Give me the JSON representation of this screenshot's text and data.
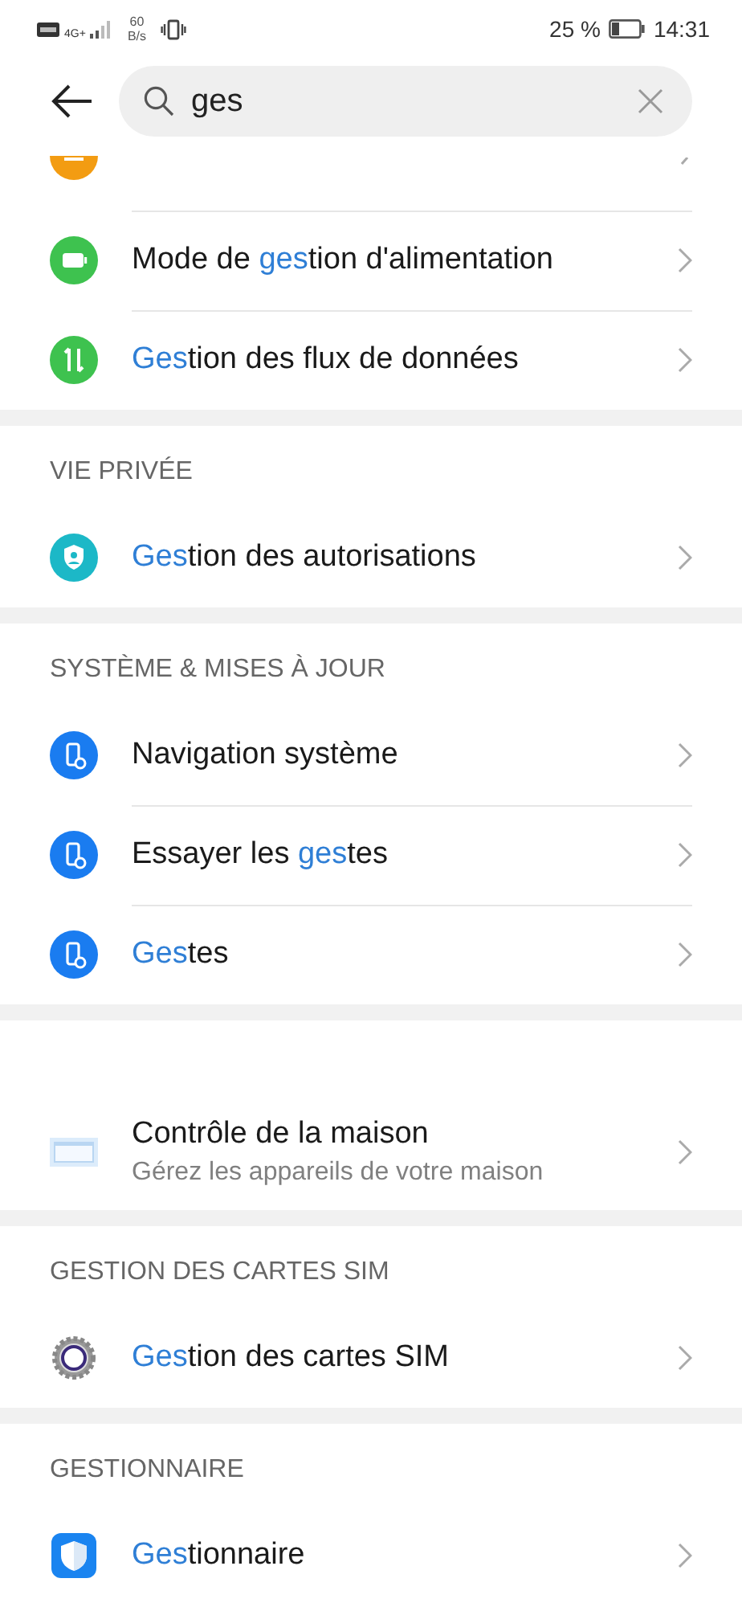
{
  "status_bar": {
    "network": "4G+",
    "speed_value": "60",
    "speed_unit": "B/s",
    "battery_percent": "25 %",
    "time": "14:31"
  },
  "search": {
    "value": "ges"
  },
  "sections": [
    {
      "items": [
        {
          "kind": "partial"
        },
        {
          "title": [
            {
              "text": "Mode de ",
              "highlighted": false
            },
            {
              "text": "ges",
              "highlighted": true
            },
            {
              "text": "tion d'alimentation",
              "highlighted": false
            }
          ]
        },
        {
          "title": [
            {
              "text": "Ges",
              "highlighted": true
            },
            {
              "text": "tion des flux de données",
              "highlighted": false
            }
          ]
        }
      ]
    },
    {
      "header": "VIE PRIVÉE",
      "items": [
        {
          "title": [
            {
              "text": "Ges",
              "highlighted": true
            },
            {
              "text": "tion des autorisations",
              "highlighted": false
            }
          ]
        }
      ]
    },
    {
      "header": "SYSTÈME & MISES À JOUR",
      "items": [
        {
          "title": [
            {
              "text": "Navigation système",
              "highlighted": false
            }
          ]
        },
        {
          "title": [
            {
              "text": "Essayer les ",
              "highlighted": false
            },
            {
              "text": "ges",
              "highlighted": true
            },
            {
              "text": "tes",
              "highlighted": false
            }
          ]
        },
        {
          "title": [
            {
              "text": "Ges",
              "highlighted": true
            },
            {
              "text": "tes",
              "highlighted": false
            }
          ]
        }
      ]
    },
    {
      "items": [
        {
          "title": [
            {
              "text": "Contrôle de la maison",
              "highlighted": false
            }
          ],
          "subtitle": "Gérez les appareils de votre maison"
        }
      ]
    },
    {
      "header": "GESTION DES CARTES SIM",
      "items": [
        {
          "title": [
            {
              "text": "Ges",
              "highlighted": true
            },
            {
              "text": "tion des cartes SIM",
              "highlighted": false
            }
          ]
        }
      ]
    },
    {
      "header": "GESTIONNAIRE",
      "items": [
        {
          "title": [
            {
              "text": "Ges",
              "highlighted": true
            },
            {
              "text": "tionnaire",
              "highlighted": false
            }
          ]
        }
      ]
    }
  ]
}
